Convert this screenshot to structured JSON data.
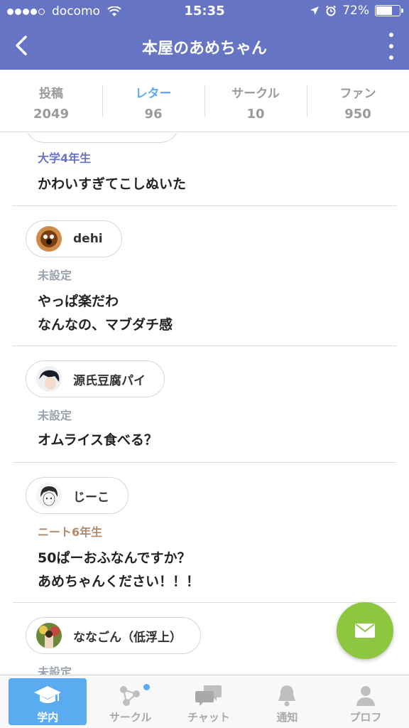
{
  "status": {
    "carrier": "docomo",
    "time": "15:35",
    "battery": "72%",
    "battery_level": 0.72
  },
  "nav": {
    "title": "本屋のあめちゃん"
  },
  "stats": [
    {
      "label": "投稿",
      "count": "2049"
    },
    {
      "label": "レター",
      "count": "96"
    },
    {
      "label": "サークル",
      "count": "10"
    },
    {
      "label": "ファン",
      "count": "950"
    }
  ],
  "letters": [
    {
      "grade": "大学4年生",
      "lines": [
        "かわいすぎてこしぬいた"
      ]
    },
    {
      "user": "dehi",
      "grade": "未設定",
      "lines": [
        "やっぱ楽だわ",
        "なんなの、マブダチ感"
      ]
    },
    {
      "user": "源氏豆腐パイ",
      "grade": "未設定",
      "lines": [
        "オムライス食べる？"
      ]
    },
    {
      "user": "じーこ",
      "grade": "ニート6年生",
      "lines": [
        "50ぱーおふなんですか？",
        "あめちゃんください！！！"
      ]
    },
    {
      "user": "ななごん（低浮上）",
      "grade": "未設定"
    }
  ],
  "tabs": [
    {
      "label": "学内"
    },
    {
      "label": "サークル"
    },
    {
      "label": "チャット"
    },
    {
      "label": "通知"
    },
    {
      "label": "プロフ"
    }
  ],
  "colors": {
    "header": "#6674c4",
    "accent": "#5aabf0",
    "fab": "#8dc63f",
    "grade_blue": "#6674c4",
    "grade_gray": "#9aa3ad",
    "grade_brown": "#b08a6a"
  }
}
